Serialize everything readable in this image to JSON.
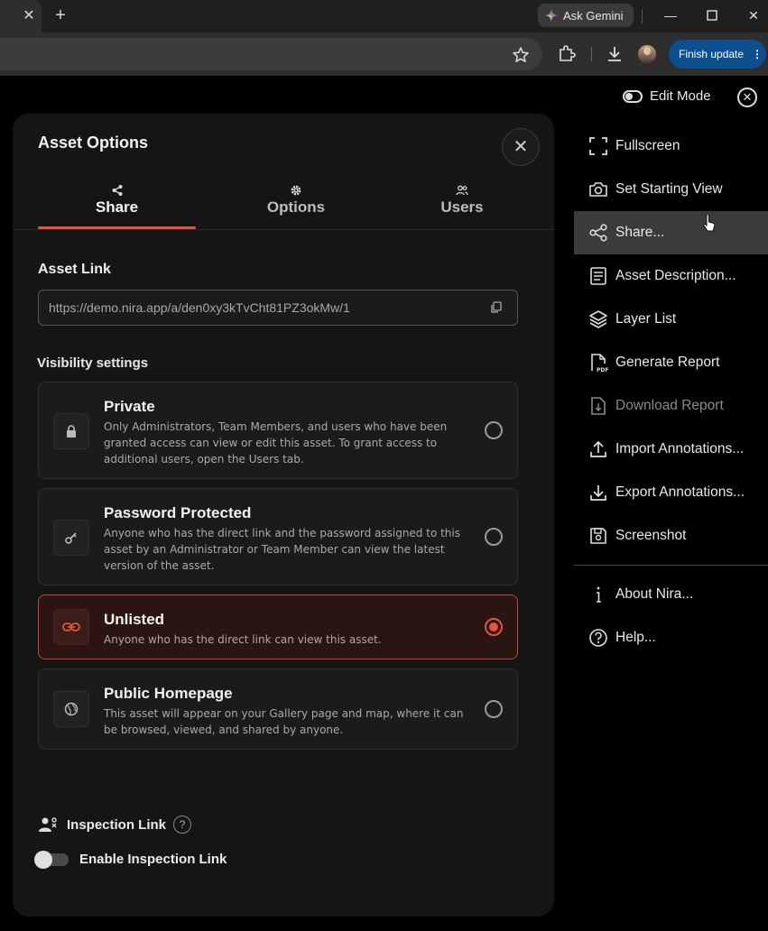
{
  "browser": {
    "ask_gemini": "Ask Gemini",
    "finish_update": "Finish update"
  },
  "app": {
    "edit_mode": "Edit Mode"
  },
  "panel": {
    "title": "Asset Options",
    "tabs": [
      {
        "label": "Share",
        "icon": "share-icon",
        "active": true
      },
      {
        "label": "Options",
        "icon": "gear-icon",
        "active": false
      },
      {
        "label": "Users",
        "icon": "users-icon",
        "active": false
      }
    ],
    "asset_link_label": "Asset Link",
    "asset_link_value": "https://demo.nira.app/a/den0xy3kTvCht81PZ3okMw/1",
    "visibility_label": "Visibility settings",
    "options": [
      {
        "title": "Private",
        "desc": "Only Administrators, Team Members, and users who have been granted access can view or edit this asset. To grant access to additional users, open the Users tab.",
        "icon": "lock-icon",
        "selected": false
      },
      {
        "title": "Password Protected",
        "desc": "Anyone who has the direct link and the password assigned to this asset by an Administrator or Team Member can view the latest version of the asset.",
        "icon": "key-icon",
        "selected": false
      },
      {
        "title": "Unlisted",
        "desc": "Anyone who has the direct link can view this asset.",
        "icon": "link-icon",
        "selected": true
      },
      {
        "title": "Public Homepage",
        "desc": "This asset will appear on your Gallery page and map, where it can be browsed, viewed, and shared by anyone.",
        "icon": "globe-icon",
        "selected": false
      }
    ],
    "inspection_link_label": "Inspection Link",
    "help_glyph": "?",
    "enable_inspection_label": "Enable Inspection Link",
    "enable_inspection_on": false
  },
  "menu": {
    "items": [
      {
        "label": "Fullscreen",
        "icon": "fullscreen-icon"
      },
      {
        "label": "Set Starting View",
        "icon": "camera-icon"
      },
      {
        "label": "Share...",
        "icon": "share-icon",
        "hovered": true
      },
      {
        "label": "Asset Description...",
        "icon": "description-icon"
      },
      {
        "label": "Layer List",
        "icon": "layers-icon"
      },
      {
        "label": "Generate Report",
        "icon": "pdf-icon"
      },
      {
        "label": "Download Report",
        "icon": "download-report-icon",
        "disabled": true
      },
      {
        "label": "Import Annotations...",
        "icon": "upload-icon"
      },
      {
        "label": "Export Annotations...",
        "icon": "download-icon"
      },
      {
        "label": "Screenshot",
        "icon": "save-icon"
      },
      {
        "label": "About Nira...",
        "icon": "info-icon"
      },
      {
        "label": "Help...",
        "icon": "help-icon"
      }
    ]
  },
  "colors": {
    "accent": "#e5533d",
    "panel_bg": "#151515",
    "update_button": "#0b4f8f"
  }
}
